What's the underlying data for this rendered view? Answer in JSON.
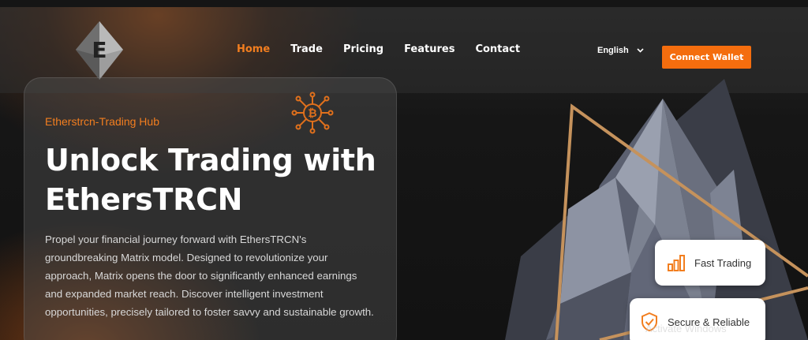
{
  "brand": {
    "logo_letter": "E"
  },
  "nav": {
    "links": [
      {
        "label": "Home",
        "active": true
      },
      {
        "label": "Trade",
        "active": false
      },
      {
        "label": "Pricing",
        "active": false
      },
      {
        "label": "Features",
        "active": false
      },
      {
        "label": "Contact",
        "active": false
      }
    ],
    "language": "English",
    "connect_label": "Connect Wallet"
  },
  "hero": {
    "eyebrow": "Etherstrcn-Trading Hub",
    "headline_line1": "Unlock Trading with",
    "headline_line2": "EthersTRCN",
    "description": "Propel your financial journey forward with EthersTRCN's groundbreaking Matrix model. Designed to revolutionize your approach, Matrix opens the door to significantly enhanced earnings and expanded market reach. Discover intelligent investment opportunities, precisely tailored to foster savvy and sustainable growth."
  },
  "features": [
    {
      "label": "Fast Trading",
      "icon": "bar-chart-icon"
    },
    {
      "label": "Secure & Reliable",
      "icon": "shield-check-icon"
    }
  ],
  "watermark": "Activate Windows",
  "colors": {
    "accent": "#f27e1f",
    "button": "#f46d0e",
    "background": "#161616"
  }
}
